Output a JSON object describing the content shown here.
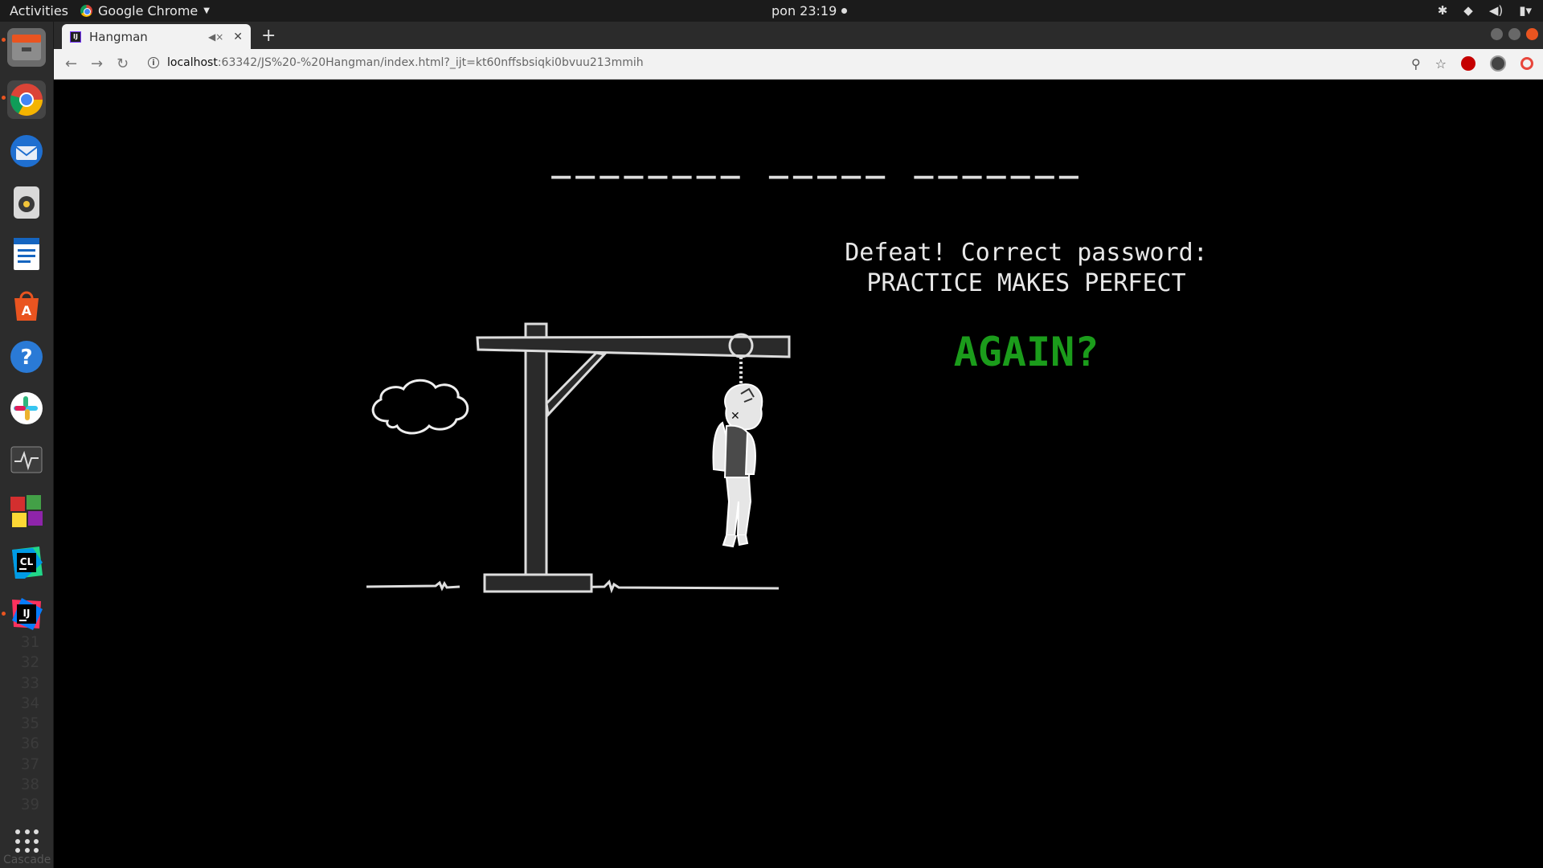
{
  "topbar": {
    "activities": "Activities",
    "app_name": "Google Chrome",
    "clock": "pon 23:19"
  },
  "dock": {
    "items": [
      "files-icon",
      "chrome-icon",
      "thunderbird-icon",
      "rhythmbox-icon",
      "writer-icon",
      "software-center-icon",
      "help-icon",
      "slack-icon",
      "system-monitor-icon",
      "color-app-icon",
      "clion-icon",
      "intellij-icon"
    ],
    "clion_label": "CL",
    "intellij_label": "IJ",
    "gutter_lines": "31\n32\n33\n34\n35\n36\n37\n38\n39",
    "cascade": "Cascade"
  },
  "browser": {
    "tab_title": "Hangman",
    "url_host": "localhost",
    "url_path": ":63342/JS%20-%20Hangman/index.html?_ijt=kt60nffsbsiqki0bvuu213mmih"
  },
  "game": {
    "masked_word": "________ _____ _______",
    "result_line_1": "Defeat! Correct password:",
    "result_line_2": "PRACTICE MAKES PERFECT",
    "again_label": "AGAIN?"
  },
  "colors": {
    "again": "#1b9c1b",
    "background": "#000000"
  }
}
